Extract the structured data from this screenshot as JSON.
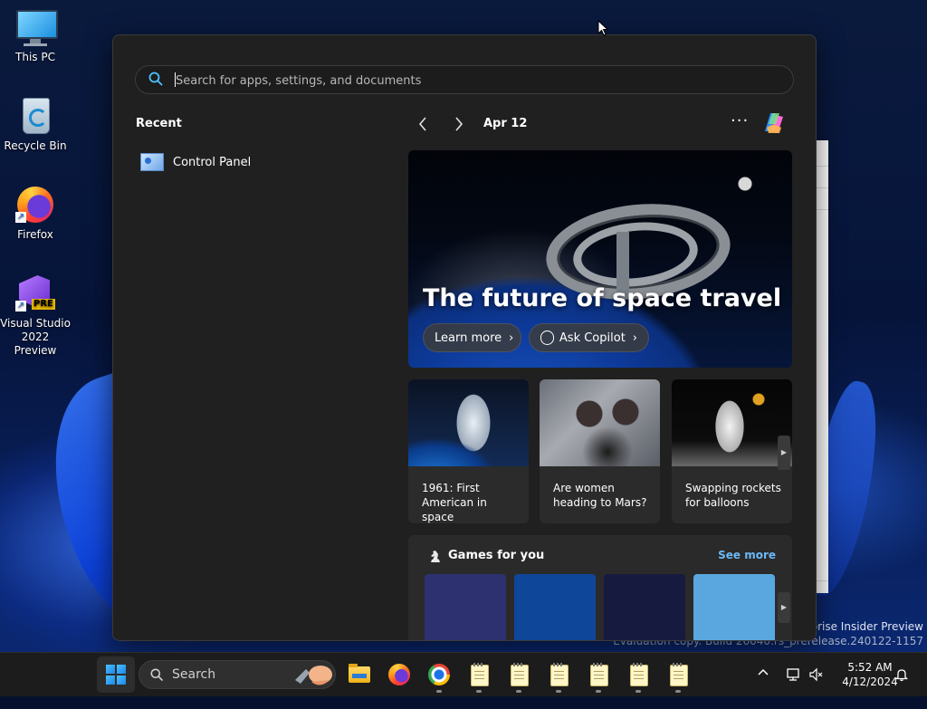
{
  "desktop": {
    "icons": [
      {
        "label": "This PC"
      },
      {
        "label": "Recycle Bin"
      },
      {
        "label": "Firefox"
      },
      {
        "label": "Visual Studio\n2022 Preview",
        "badge": "PRE"
      }
    ],
    "watermark": {
      "line1": "erprise Insider Preview",
      "line2": "Evaluation copy. Build 26040.rs_prerelease.240122-1157"
    }
  },
  "search_panel": {
    "search": {
      "placeholder": "Search for apps, settings, and documents",
      "value": ""
    },
    "recent": {
      "title": "Recent",
      "items": [
        {
          "label": "Control Panel",
          "icon": "control-panel-icon"
        }
      ]
    },
    "highlights": {
      "date": "Apr 12",
      "more_label": "···",
      "hero": {
        "title": "The future of space travel",
        "learn_more": "Learn more",
        "ask_copilot": "Ask Copilot"
      },
      "cards": [
        {
          "caption": "1961: First American in space"
        },
        {
          "caption": "Are women heading to Mars?"
        },
        {
          "caption": "Swapping rockets for balloons"
        }
      ],
      "games": {
        "title": "Games for you",
        "see_more": "See more",
        "tile_colors": [
          "#2e3170",
          "#0e4699",
          "#171a3f",
          "#5aa7df"
        ]
      }
    }
  },
  "taskbar": {
    "search_label": "Search",
    "apps": [
      "file-explorer-icon",
      "firefox-icon",
      "chrome-icon",
      "notepad-icon",
      "notepad-icon",
      "notepad-icon",
      "notepad-icon",
      "notepad-icon",
      "notepad-icon"
    ],
    "clock": {
      "time": "5:52 AM",
      "date": "4/12/2024"
    }
  },
  "colors": {
    "panel_bg": "#202020",
    "accent_link": "#6cb8f6",
    "taskbar_bg": "#1c1c1c"
  }
}
